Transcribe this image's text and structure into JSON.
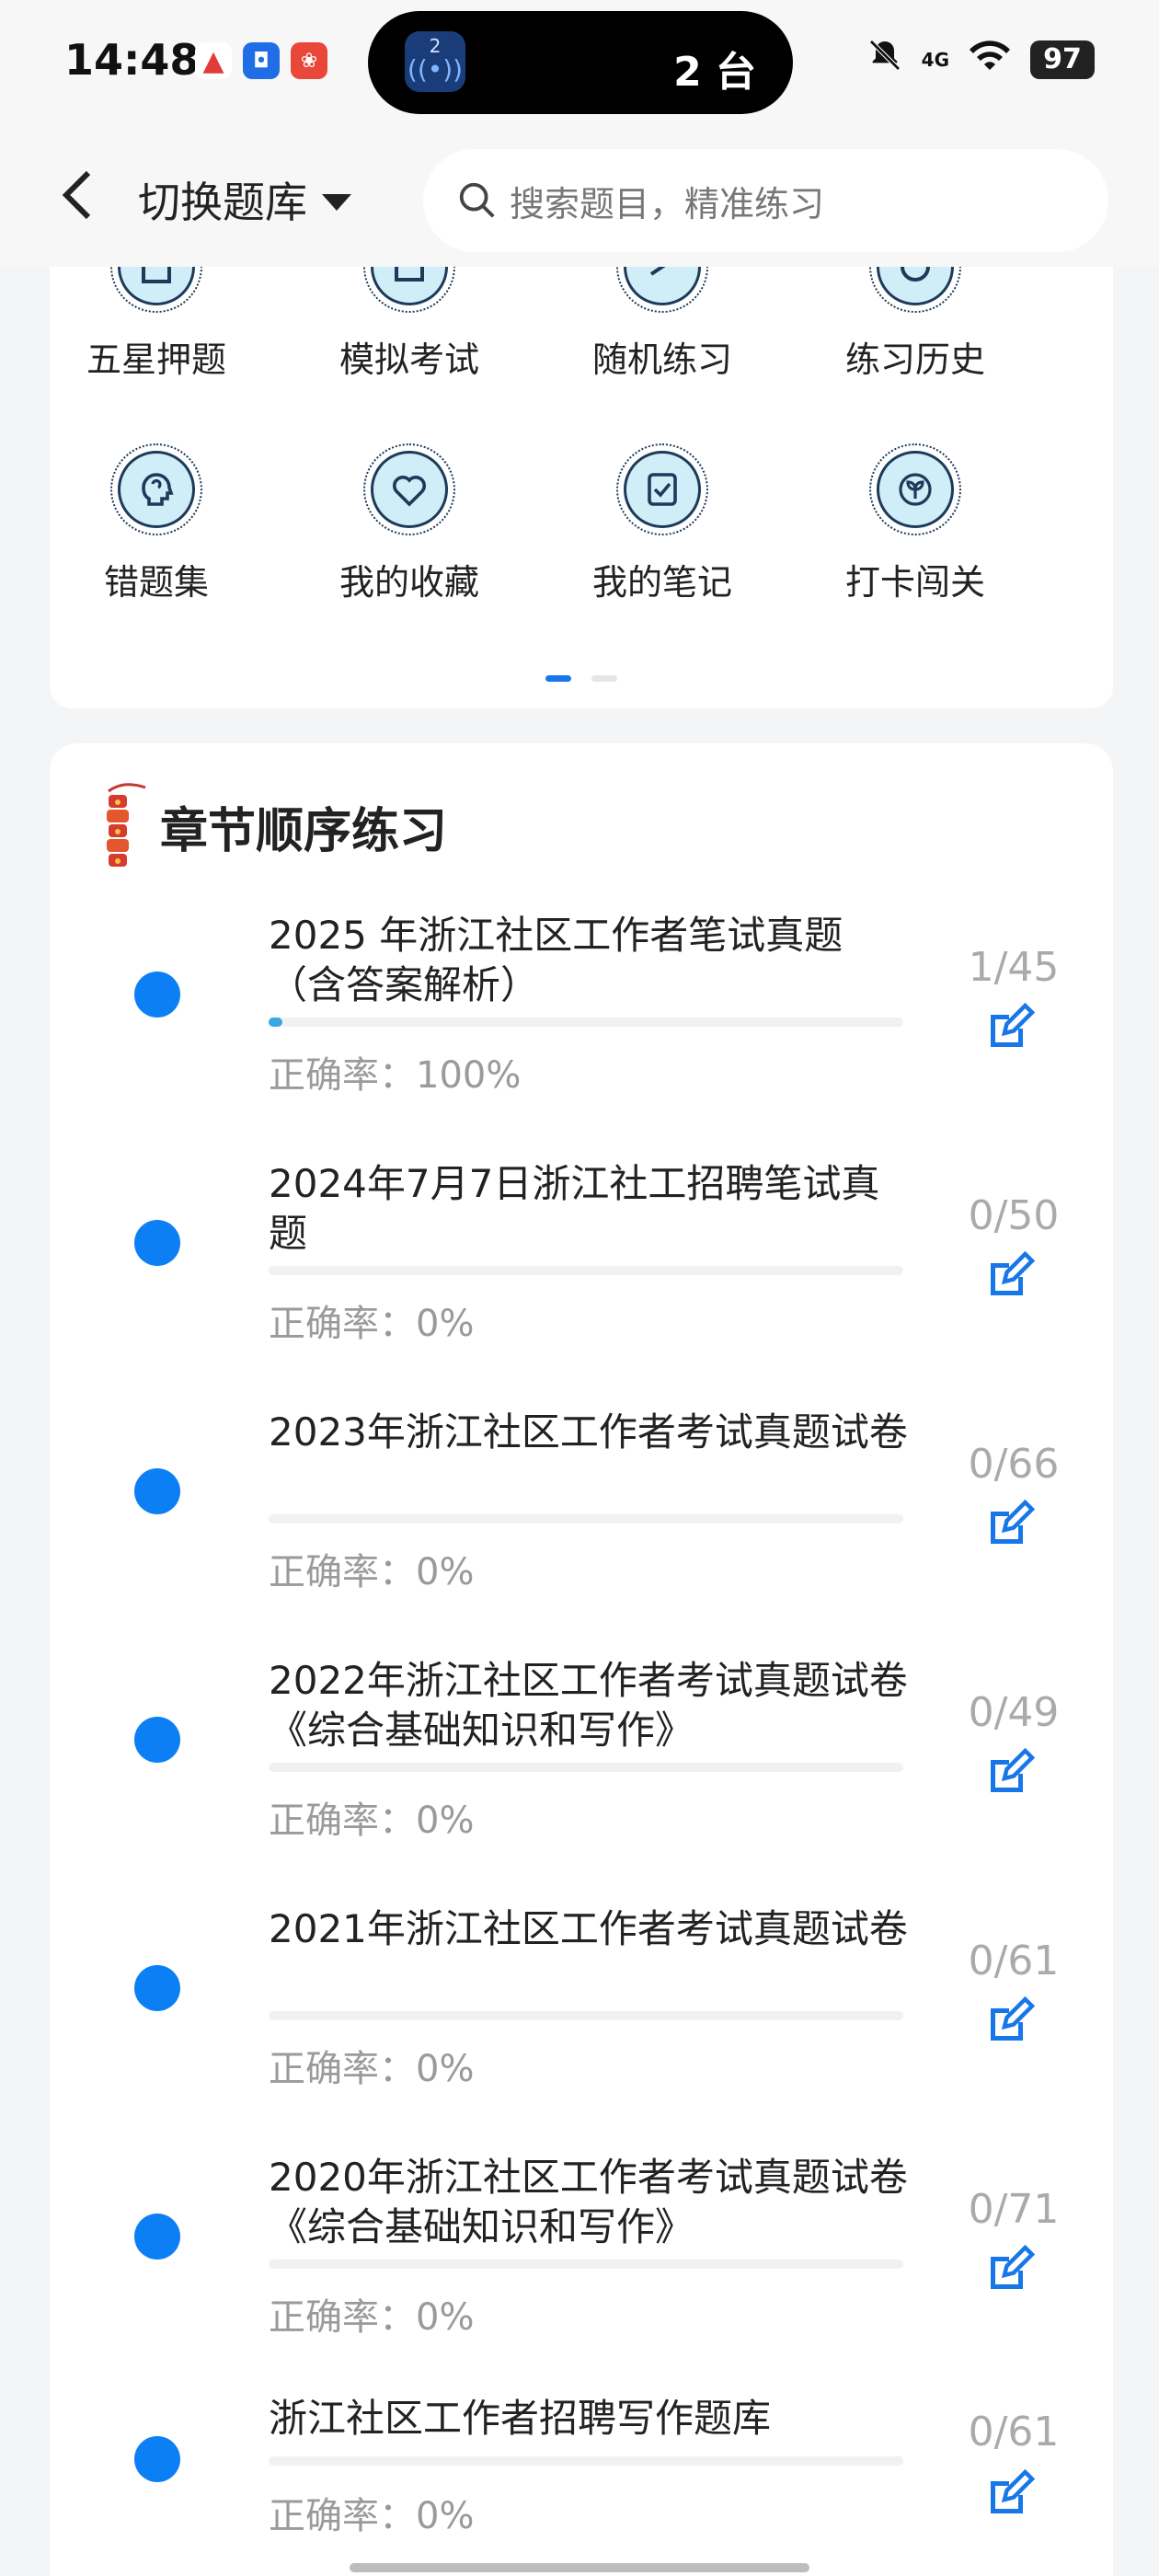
{
  "status_bar": {
    "time": "14:48",
    "island_badge": "2",
    "island_text": "2 台",
    "network": "4G",
    "battery": "97"
  },
  "header": {
    "back_icon": "chevron-left-icon",
    "switch_label": "切换题库",
    "search_placeholder": "搜索题目，精准练习"
  },
  "grid": {
    "row1": [
      {
        "label": "五星押题",
        "icon": "clipboard-icon"
      },
      {
        "label": "模拟考试",
        "icon": "exam-icon"
      },
      {
        "label": "随机练习",
        "icon": "random-icon"
      },
      {
        "label": "练习历史",
        "icon": "history-icon"
      }
    ],
    "row2": [
      {
        "label": "错题集",
        "icon": "head-icon"
      },
      {
        "label": "我的收藏",
        "icon": "heart-icon"
      },
      {
        "label": "我的笔记",
        "icon": "note-check-icon"
      },
      {
        "label": "打卡闯关",
        "icon": "sprout-icon"
      }
    ],
    "page_indicator": {
      "pages": 2,
      "active": 0
    }
  },
  "chapter": {
    "title": "章节顺序练习",
    "items": [
      {
        "title": "2025 年浙江社区工作者笔试真题（含答案解析）",
        "accuracy": "正确率：100%",
        "count": "1/45",
        "progress": 0.022
      },
      {
        "title": "2024年7月7日浙江社工招聘笔试真题",
        "accuracy": "正确率：0%",
        "count": "0/50",
        "progress": 0
      },
      {
        "title": "2023年浙江社区工作者考试真题试卷",
        "accuracy": "正确率：0%",
        "count": "0/66",
        "progress": 0
      },
      {
        "title": "2022年浙江社区工作者考试真题试卷 《综合基础知识和写作》",
        "accuracy": "正确率：0%",
        "count": "0/49",
        "progress": 0
      },
      {
        "title": "2021年浙江社区工作者考试真题试卷",
        "accuracy": "正确率：0%",
        "count": "0/61",
        "progress": 0
      },
      {
        "title": "2020年浙江社区工作者考试真题试卷 《综合基础知识和写作》",
        "accuracy": "正确率：0%",
        "count": "0/71",
        "progress": 0
      },
      {
        "title": "浙江社区工作者招聘写作题库",
        "accuracy": "正确率：0%",
        "count": "0/61",
        "progress": 0
      }
    ]
  },
  "colors": {
    "accent": "#1877e8",
    "dot": "#0d7ff5",
    "icon_fill": "#cfeef7",
    "muted": "#9a9a9a"
  }
}
